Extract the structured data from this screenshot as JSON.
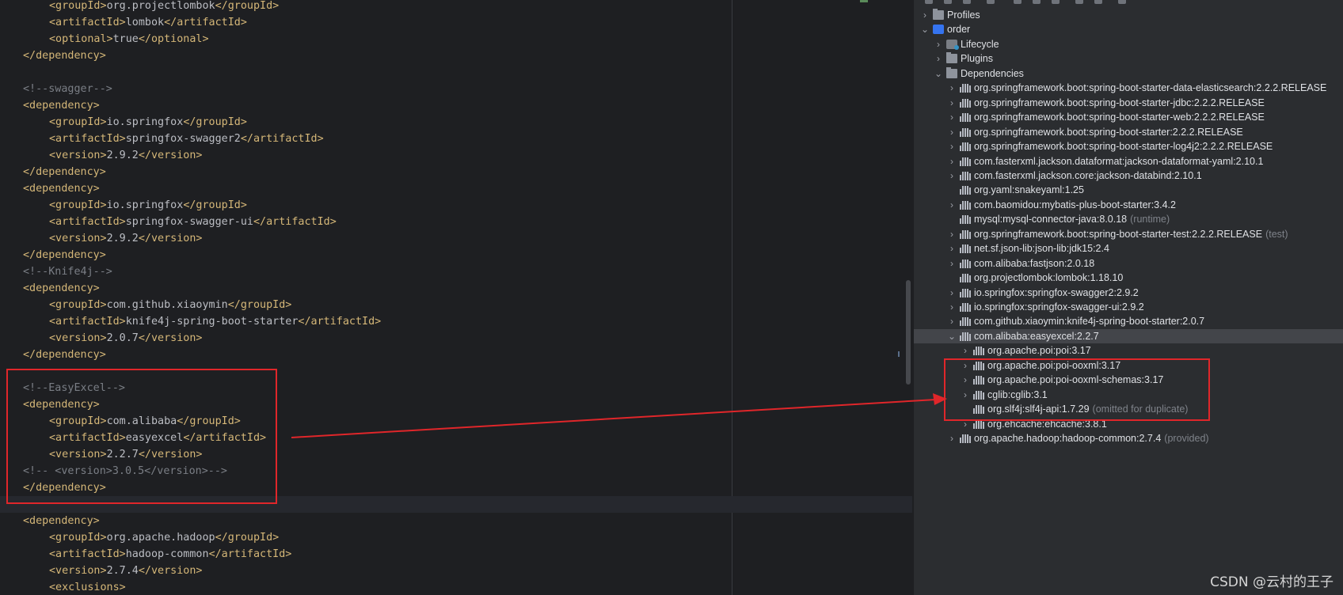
{
  "editor": {
    "lines": [
      {
        "kind": "el",
        "indent": 2,
        "tag": "groupId",
        "text": "org.projectlombok"
      },
      {
        "kind": "el",
        "indent": 2,
        "tag": "artifactId",
        "text": "lombok"
      },
      {
        "kind": "el",
        "indent": 2,
        "tag": "optional",
        "text": "true"
      },
      {
        "kind": "close",
        "indent": 1,
        "tag": "dependency"
      },
      {
        "kind": "blank"
      },
      {
        "kind": "comment",
        "indent": 1,
        "text": "<!--swagger-->"
      },
      {
        "kind": "open",
        "indent": 1,
        "tag": "dependency"
      },
      {
        "kind": "el",
        "indent": 2,
        "tag": "groupId",
        "text": "io.springfox"
      },
      {
        "kind": "el",
        "indent": 2,
        "tag": "artifactId",
        "text": "springfox-swagger2"
      },
      {
        "kind": "el",
        "indent": 2,
        "tag": "version",
        "text": "2.9.2"
      },
      {
        "kind": "close",
        "indent": 1,
        "tag": "dependency"
      },
      {
        "kind": "open",
        "indent": 1,
        "tag": "dependency"
      },
      {
        "kind": "el",
        "indent": 2,
        "tag": "groupId",
        "text": "io.springfox"
      },
      {
        "kind": "el",
        "indent": 2,
        "tag": "artifactId",
        "text": "springfox-swagger-ui"
      },
      {
        "kind": "el",
        "indent": 2,
        "tag": "version",
        "text": "2.9.2"
      },
      {
        "kind": "close",
        "indent": 1,
        "tag": "dependency"
      },
      {
        "kind": "comment",
        "indent": 1,
        "text": "<!--Knife4j-->"
      },
      {
        "kind": "open",
        "indent": 1,
        "tag": "dependency"
      },
      {
        "kind": "el",
        "indent": 2,
        "tag": "groupId",
        "text": "com.github.xiaoymin"
      },
      {
        "kind": "el",
        "indent": 2,
        "tag": "artifactId",
        "text": "knife4j-spring-boot-starter"
      },
      {
        "kind": "el",
        "indent": 2,
        "tag": "version",
        "text": "2.0.7"
      },
      {
        "kind": "close",
        "indent": 1,
        "tag": "dependency"
      },
      {
        "kind": "blank"
      },
      {
        "kind": "comment",
        "indent": 1,
        "text": "<!--EasyExcel-->"
      },
      {
        "kind": "open",
        "indent": 1,
        "tag": "dependency"
      },
      {
        "kind": "el",
        "indent": 2,
        "tag": "groupId",
        "text": "com.alibaba"
      },
      {
        "kind": "el",
        "indent": 2,
        "tag": "artifactId",
        "text": "easyexcel"
      },
      {
        "kind": "el",
        "indent": 2,
        "tag": "version",
        "text": "2.2.7"
      },
      {
        "kind": "comment",
        "indent": 1,
        "text": "<!-- <version>3.0.5</version>-->"
      },
      {
        "kind": "close",
        "indent": 1,
        "tag": "dependency"
      },
      {
        "kind": "blank",
        "caret": true
      },
      {
        "kind": "open",
        "indent": 1,
        "tag": "dependency"
      },
      {
        "kind": "el",
        "indent": 2,
        "tag": "groupId",
        "text": "org.apache.hadoop"
      },
      {
        "kind": "el",
        "indent": 2,
        "tag": "artifactId",
        "text": "hadoop-common"
      },
      {
        "kind": "el",
        "indent": 2,
        "tag": "version",
        "text": "2.7.4"
      },
      {
        "kind": "open",
        "indent": 2,
        "tag": "exclusions"
      }
    ]
  },
  "maven": {
    "rows": [
      {
        "level": 0,
        "chev": ">",
        "icon": "folder",
        "label": "Profiles"
      },
      {
        "level": 0,
        "chev": "v",
        "icon": "maven",
        "label": "order"
      },
      {
        "level": 1,
        "chev": ">",
        "icon": "gear",
        "label": "Lifecycle"
      },
      {
        "level": 1,
        "chev": ">",
        "icon": "folder",
        "label": "Plugins"
      },
      {
        "level": 1,
        "chev": "v",
        "icon": "folder",
        "label": "Dependencies"
      },
      {
        "level": 2,
        "chev": ">",
        "icon": "lib",
        "label": "org.springframework.boot:spring-boot-starter-data-elasticsearch:2.2.2.RELEASE",
        "note": ""
      },
      {
        "level": 2,
        "chev": ">",
        "icon": "lib",
        "label": "org.springframework.boot:spring-boot-starter-jdbc:2.2.2.RELEASE",
        "note": ""
      },
      {
        "level": 2,
        "chev": ">",
        "icon": "lib",
        "label": "org.springframework.boot:spring-boot-starter-web:2.2.2.RELEASE",
        "note": ""
      },
      {
        "level": 2,
        "chev": ">",
        "icon": "lib",
        "label": "org.springframework.boot:spring-boot-starter:2.2.2.RELEASE",
        "note": ""
      },
      {
        "level": 2,
        "chev": ">",
        "icon": "lib",
        "label": "org.springframework.boot:spring-boot-starter-log4j2:2.2.2.RELEASE",
        "note": ""
      },
      {
        "level": 2,
        "chev": ">",
        "icon": "lib",
        "label": "com.fasterxml.jackson.dataformat:jackson-dataformat-yaml:2.10.1",
        "note": ""
      },
      {
        "level": 2,
        "chev": ">",
        "icon": "lib",
        "label": "com.fasterxml.jackson.core:jackson-databind:2.10.1",
        "note": ""
      },
      {
        "level": 2,
        "chev": "",
        "icon": "lib",
        "label": "org.yaml:snakeyaml:1.25",
        "note": ""
      },
      {
        "level": 2,
        "chev": ">",
        "icon": "lib",
        "label": "com.baomidou:mybatis-plus-boot-starter:3.4.2",
        "note": ""
      },
      {
        "level": 2,
        "chev": "",
        "icon": "lib",
        "label": "mysql:mysql-connector-java:8.0.18",
        "note": "(runtime)"
      },
      {
        "level": 2,
        "chev": ">",
        "icon": "lib",
        "label": "org.springframework.boot:spring-boot-starter-test:2.2.2.RELEASE",
        "note": "(test)"
      },
      {
        "level": 2,
        "chev": ">",
        "icon": "lib",
        "label": "net.sf.json-lib:json-lib:jdk15:2.4",
        "note": ""
      },
      {
        "level": 2,
        "chev": ">",
        "icon": "lib",
        "label": "com.alibaba:fastjson:2.0.18",
        "note": ""
      },
      {
        "level": 2,
        "chev": "",
        "icon": "lib",
        "label": "org.projectlombok:lombok:1.18.10",
        "note": ""
      },
      {
        "level": 2,
        "chev": ">",
        "icon": "lib",
        "label": "io.springfox:springfox-swagger2:2.9.2",
        "note": ""
      },
      {
        "level": 2,
        "chev": ">",
        "icon": "lib",
        "label": "io.springfox:springfox-swagger-ui:2.9.2",
        "note": ""
      },
      {
        "level": 2,
        "chev": ">",
        "icon": "lib",
        "label": "com.github.xiaoymin:knife4j-spring-boot-starter:2.0.7",
        "note": ""
      },
      {
        "level": 2,
        "chev": "v",
        "icon": "lib",
        "label": "com.alibaba:easyexcel:2.2.7",
        "note": "",
        "selected": true
      },
      {
        "level": 3,
        "chev": ">",
        "icon": "lib",
        "label": "org.apache.poi:poi:3.17",
        "note": ""
      },
      {
        "level": 3,
        "chev": ">",
        "icon": "lib",
        "label": "org.apache.poi:poi-ooxml:3.17",
        "note": ""
      },
      {
        "level": 3,
        "chev": ">",
        "icon": "lib",
        "label": "org.apache.poi:poi-ooxml-schemas:3.17",
        "note": ""
      },
      {
        "level": 3,
        "chev": ">",
        "icon": "lib",
        "label": "cglib:cglib:3.1",
        "note": ""
      },
      {
        "level": 3,
        "chev": "",
        "icon": "lib",
        "label": "org.slf4j:slf4j-api:1.7.29",
        "note": "(omitted for duplicate)"
      },
      {
        "level": 3,
        "chev": ">",
        "icon": "lib",
        "label": "org.ehcache:ehcache:3.8.1",
        "note": ""
      },
      {
        "level": 2,
        "chev": ">",
        "icon": "lib",
        "label": "org.apache.hadoop:hadoop-common:2.7.4",
        "note": "(provided)"
      }
    ]
  },
  "watermark": "CSDN @云村的王子",
  "colors": {
    "annotation": "#e0262a",
    "tag": "#d5b778",
    "comment": "#7a7e85",
    "text": "#bcbec4"
  }
}
